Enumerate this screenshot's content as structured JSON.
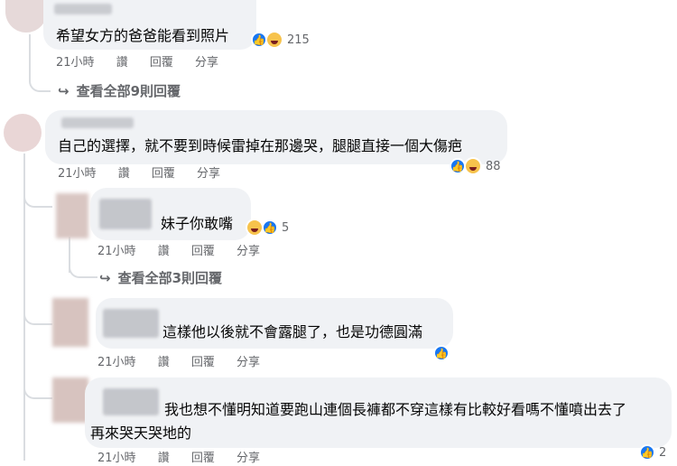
{
  "comments": [
    {
      "text": "希望女方的爸爸能看到照片",
      "reactions": "215",
      "time": "21小時",
      "like": "讚",
      "reply": "回覆",
      "share": "分享",
      "view_more": "查看全部9則回覆"
    },
    {
      "text": "自己的選擇，就不要到時候雷掉在那邊哭，腿腿直接一個大傷疤",
      "reactions": "88",
      "time": "21小時",
      "like": "讚",
      "reply": "回覆",
      "share": "分享"
    },
    {
      "text": "妹子你敢嘴",
      "reactions": "5",
      "time": "21小時",
      "like": "讚",
      "reply": "回覆",
      "share": "分享",
      "view_more": "查看全部3則回覆"
    },
    {
      "text": "這樣他以後就不會露腿了，也是功德圓滿",
      "time": "21小時",
      "like": "讚",
      "reply": "回覆",
      "share": "分享"
    },
    {
      "text_line1": "我也想不懂明知道要跑山連個長褲都不穿這樣有比較好看嗎不懂噴出去了",
      "text_line2": "再來哭天哭地的",
      "reactions": "2",
      "time": "21小時",
      "like": "讚",
      "reply": "回覆",
      "share": "分享"
    }
  ],
  "icons": {
    "like": "like-reaction-icon",
    "haha": "haha-reaction-icon",
    "reply_arrow": "reply-arrow-icon"
  },
  "colors": {
    "like": "#1877f2",
    "haha": "#f7c34c",
    "bubble": "#f0f2f5",
    "meta": "#65676b"
  }
}
